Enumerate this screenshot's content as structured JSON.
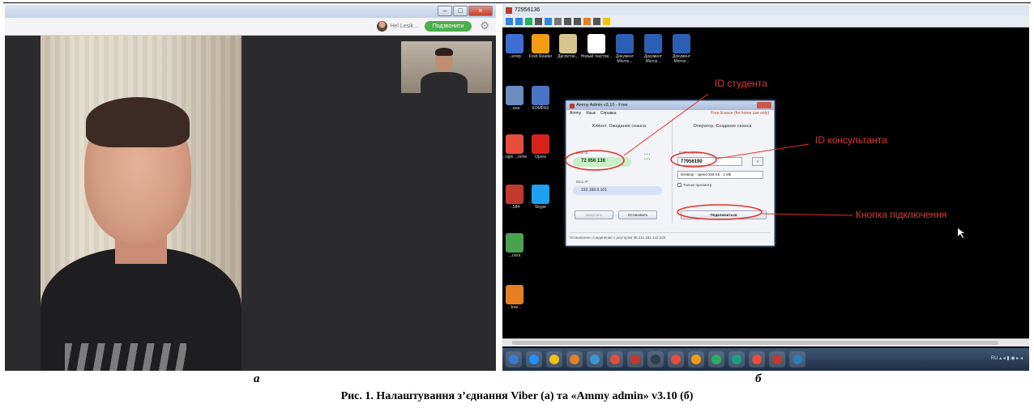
{
  "figure": {
    "label_a": "а",
    "label_b": "б",
    "caption": "Рис. 1. Налаштування з’єднання Viber (а) та «Ammy admin» v3.10 (б)"
  },
  "viber": {
    "user_name": "Hel Lesik...",
    "status_button": "Подзвонити"
  },
  "remote_window": {
    "title": "72956136",
    "desktop_icons": [
      {
        "label": "...ютер",
        "color": "#3c6fd1"
      },
      {
        "label": "Foxit Reader",
        "color": "#f39c12"
      },
      {
        "label": "Диспетче...",
        "color": "#d8c58b"
      },
      {
        "label": "Новый текстов...",
        "color": "#ffffff"
      },
      {
        "label": "Документ Micros...",
        "color": "#2b5fb4"
      },
      {
        "label": "Документ Micros...",
        "color": "#2b5fb4"
      },
      {
        "label": "Документ Micros...",
        "color": "#2b5fb4"
      },
      {
        "label": "...ина",
        "color": "#6b8cbf"
      },
      {
        "label": "KOMPAS",
        "color": "#4b73c5"
      },
      {
        "label": "...ogle ...rome",
        "color": "#e74c3c"
      },
      {
        "label": "Opera",
        "color": "#d6221b"
      },
      {
        "label": "...584",
        "color": "#c0392b"
      },
      {
        "label": "Skype",
        "color": "#1ea0f0"
      },
      {
        "label": "...rrent",
        "color": "#48a14d"
      },
      {
        "label": "...free...",
        "color": "#e67e22"
      }
    ]
  },
  "ammy": {
    "title": "Ammy Admin v3.10 - Free",
    "menu": [
      "Ammy",
      "Язык",
      "Справка"
    ],
    "licence": "Free licence (for home use only)",
    "client_header": "Клиент. Ожидание сеанса",
    "operator_header": "Оператор. Создание сеанса",
    "your_id_label": "Ваш ID",
    "your_id": "72 956 136",
    "your_ip_label": "Ваш IP",
    "your_ip": "192.168.0.101",
    "client_id_label": "ID/IP клиента",
    "client_id": "77956190",
    "speed": "Desktop - speed 256 Kb - 1 Mb",
    "view_only": "Только просмотр",
    "start_btn": "Запустить",
    "stop_btn": "Остановить",
    "connect_btn": "Подключиться",
    "status": "Установлено соединение с роутером 95.211.191.142:443"
  },
  "annotations": {
    "student_id": "ID студента",
    "consultant_id": "ID консультанта",
    "connect_button": "Кнопка підключення"
  },
  "taskbar": {
    "apps": [
      "#3a7bd5",
      "#1e90ff",
      "#f1c40f",
      "#e67e22",
      "#3498db",
      "#e74c3c",
      "#c0392b",
      "#2c3e50",
      "#e74c3c",
      "#f39c12",
      "#27ae60",
      "#16a085",
      "#e74c3c",
      "#c0392b",
      "#2980b9"
    ],
    "tray_text": "RU ▴ ◂ ▮ ◉ ▸ ◂"
  }
}
